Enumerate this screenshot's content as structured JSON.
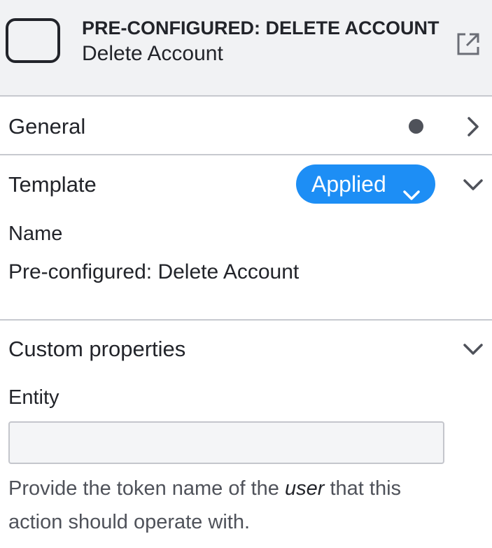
{
  "header": {
    "type_label": "PRE-CONFIGURED: DELETE ACCOUNT",
    "name": "Delete Account",
    "task_icon": "rounded-square-icon",
    "link_icon": "external-link-icon"
  },
  "sections": {
    "general": {
      "title": "General",
      "status_icon": "dot-icon",
      "state": "collapsed"
    },
    "template": {
      "title": "Template",
      "badge": "Applied",
      "state": "expanded",
      "name_label": "Name",
      "name_value": "Pre-configured: Delete Account"
    },
    "custom": {
      "title": "Custom properties",
      "state": "expanded",
      "entity_label": "Entity",
      "entity_value": "",
      "help_prefix": "Provide the token name of the ",
      "help_emphasis": "user",
      "help_suffix": " that this action should operate with."
    }
  },
  "colors": {
    "accent": "#1d8ef5",
    "header_bg": "#f1f2f4",
    "text": "#22242a",
    "muted_text": "#4f525a",
    "divider": "#c7c9cf"
  }
}
